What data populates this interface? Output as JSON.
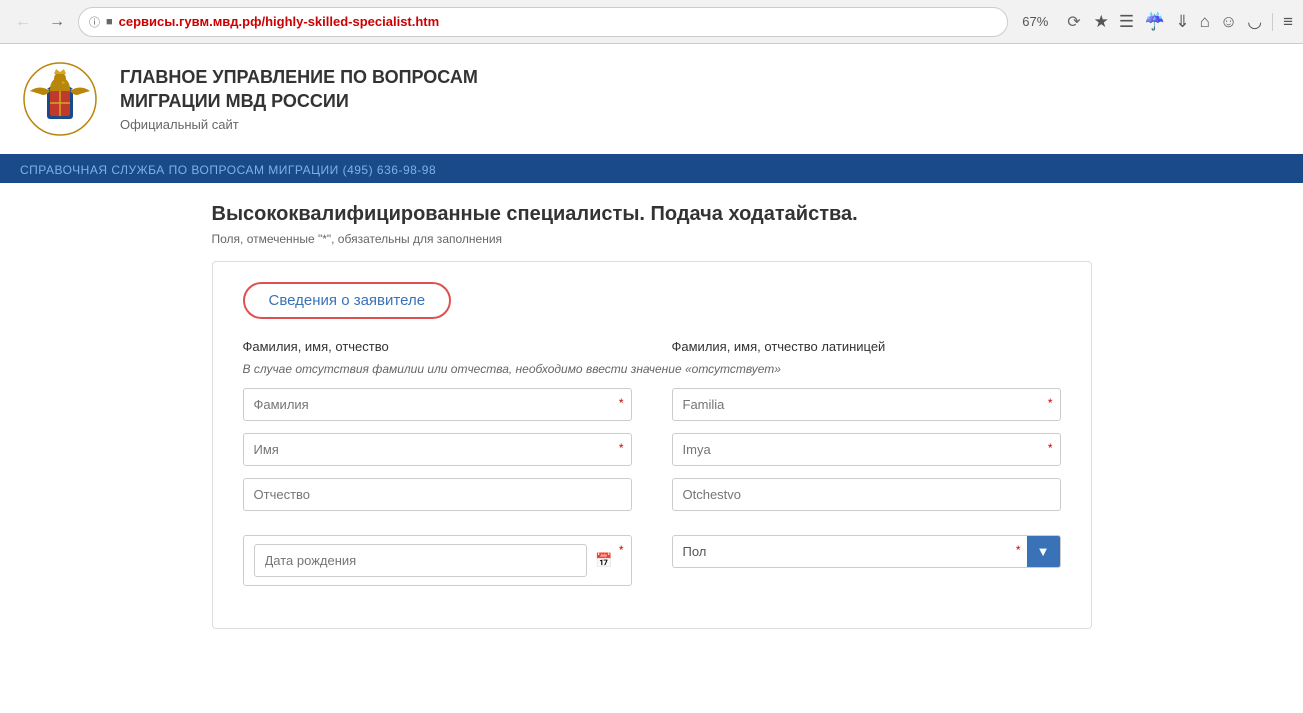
{
  "browser": {
    "url_prefix": "сервисы.гувм.",
    "url_domain": "мвд.рф",
    "url_path": "/highly-skilled-specialist.htm",
    "zoom": "67%",
    "back_btn": "←",
    "forward_btn": "→",
    "reload_btn": "↻",
    "home_btn": "⌂"
  },
  "header": {
    "title_line1": "ГЛАВНОЕ УПРАВЛЕНИЕ ПО ВОПРОСАМ",
    "title_line2": "МИГРАЦИИ МВД РОССИИ",
    "subtitle": "Официальный сайт"
  },
  "info_bar": {
    "text": "СПРАВОЧНАЯ СЛУЖБА ПО ВОПРОСАМ МИГРАЦИИ (495) 636-98-98"
  },
  "page": {
    "title": "Высококвалифицированные специалисты. Подача ходатайства.",
    "required_note": "Поля, отмеченные \"*\", обязательны для заполнения"
  },
  "form": {
    "section_title": "Сведения о заявителе",
    "col1_header": "Фамилия, имя, отчество",
    "col2_header": "Фамилия, имя, отчество латиницей",
    "absence_note": "В случае отсутствия фамилии или отчества, необходимо ввести значение «отсутствует»",
    "fields": {
      "last_name_placeholder": "Фамилия",
      "first_name_placeholder": "Имя",
      "patronymic_placeholder": "Отчество",
      "last_name_latin_placeholder": "Familia",
      "first_name_latin_placeholder": "Imya",
      "patronymic_latin_placeholder": "Otchestvo",
      "birthdate_placeholder": "Дата рождения",
      "gender_placeholder": "Пол"
    }
  }
}
